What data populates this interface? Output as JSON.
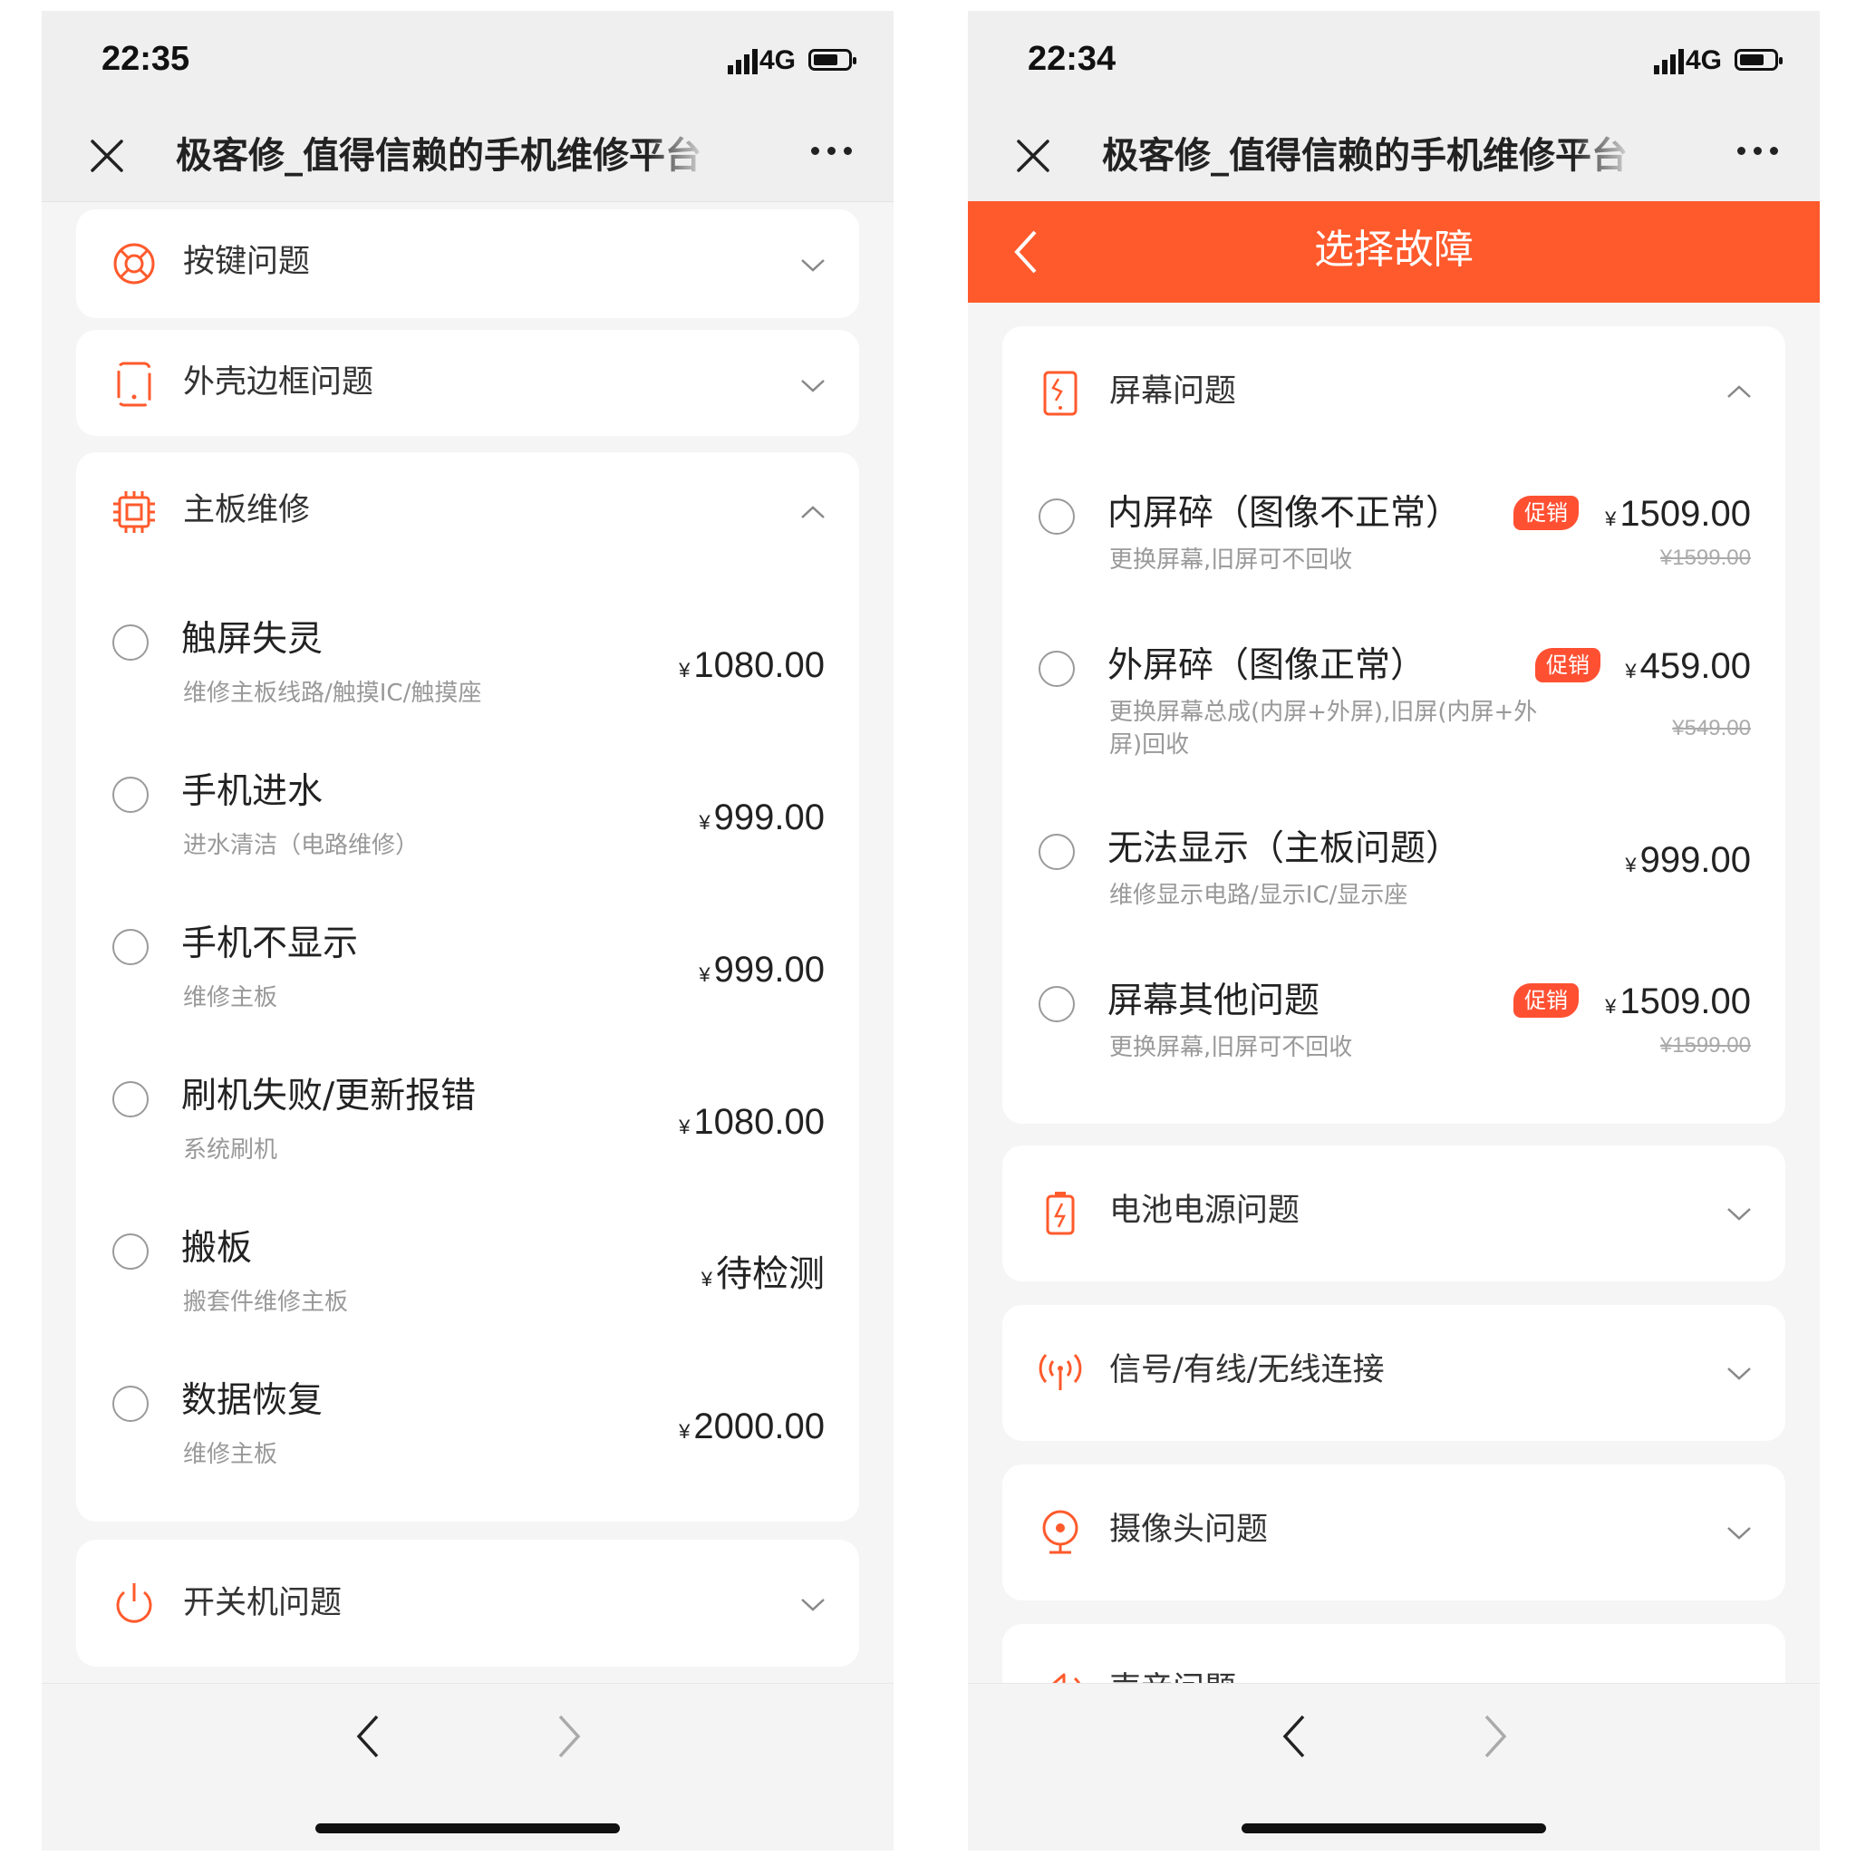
{
  "colors": {
    "accent": "#ff5a2c",
    "promo": "#ff5032",
    "icon": "#ff5a2c"
  },
  "left": {
    "status": {
      "time": "22:35",
      "network": "4G"
    },
    "nav": {
      "title": "极客修_值得信赖的手机维修平台"
    },
    "sections": {
      "keys": {
        "label": "按键问题",
        "icon": "lifebuoy-icon"
      },
      "frame": {
        "label": "外壳边框问题",
        "icon": "phone-frame-icon"
      },
      "board": {
        "label": "主板维修",
        "icon": "chip-icon",
        "items": [
          {
            "name": "触屏失灵",
            "desc": "维修主板线路/触摸IC/触摸座",
            "currency": "¥",
            "price": "1080.00"
          },
          {
            "name": "手机进水",
            "desc": "进水清洁（电路维修）",
            "currency": "¥",
            "price": "999.00"
          },
          {
            "name": "手机不显示",
            "desc": "维修主板",
            "currency": "¥",
            "price": "999.00"
          },
          {
            "name": "刷机失败/更新报错",
            "desc": "系统刷机",
            "currency": "¥",
            "price": "1080.00"
          },
          {
            "name": "搬板",
            "desc": "搬套件维修主板",
            "currency": "¥",
            "price": "待检测"
          },
          {
            "name": "数据恢复",
            "desc": "维修主板",
            "currency": "¥",
            "price": "2000.00"
          }
        ]
      },
      "power": {
        "label": "开关机问题",
        "icon": "power-icon"
      }
    }
  },
  "right": {
    "status": {
      "time": "22:34",
      "network": "4G"
    },
    "nav": {
      "title": "极客修_值得信赖的手机维修平台"
    },
    "header": {
      "title": "选择故障"
    },
    "sections": {
      "screen": {
        "label": "屏幕问题",
        "icon": "broken-screen-icon",
        "items": [
          {
            "name": "内屏碎（图像不正常）",
            "promo": "促销",
            "currency": "¥",
            "price": "1509.00",
            "old_price": "¥1599.00",
            "desc": "更换屏幕,旧屏可不回收"
          },
          {
            "name": "外屏碎（图像正常）",
            "promo": "促销",
            "currency": "¥",
            "price": "459.00",
            "old_price": "¥549.00",
            "desc": "更换屏幕总成(内屏+外屏),旧屏(内屏+外屏)回收"
          },
          {
            "name": "无法显示（主板问题）",
            "currency": "¥",
            "price": "999.00",
            "desc": "维修显示电路/显示IC/显示座"
          },
          {
            "name": "屏幕其他问题",
            "promo": "促销",
            "currency": "¥",
            "price": "1509.00",
            "old_price": "¥1599.00",
            "desc": "更换屏幕,旧屏可不回收"
          }
        ]
      },
      "battery": {
        "label": "电池电源问题",
        "icon": "battery-icon"
      },
      "signal": {
        "label": "信号/有线/无线连接",
        "icon": "signal-icon"
      },
      "camera": {
        "label": "摄像头问题",
        "icon": "camera-icon"
      },
      "sound": {
        "label": "声音问题",
        "icon": "speaker-icon"
      }
    }
  }
}
